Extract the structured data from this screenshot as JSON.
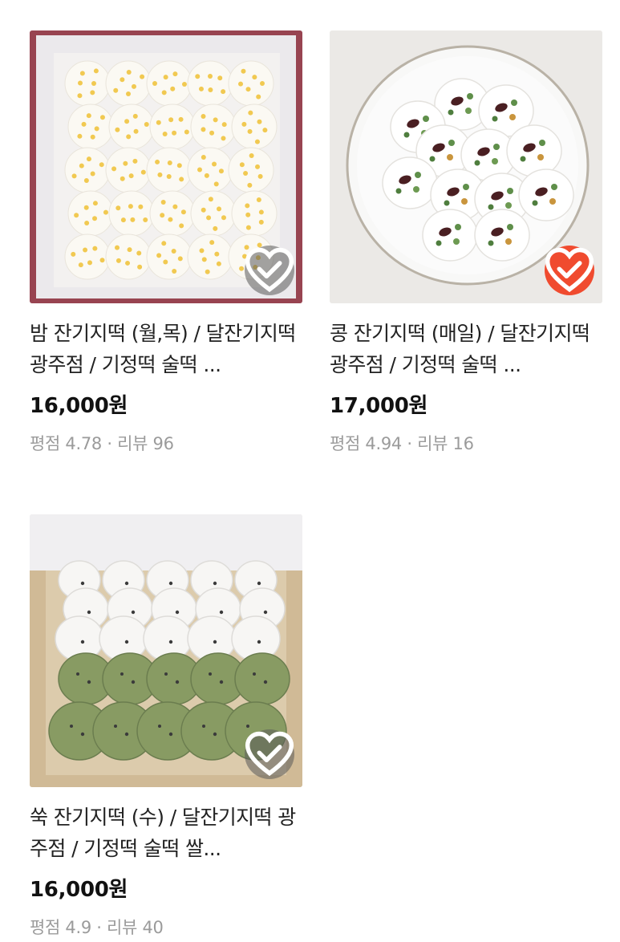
{
  "products": [
    {
      "title": "밤 잔기지떡 (월,목) / 달잔기지떡 광주점 / 기정떡 술떡 ...",
      "price": "16,000원",
      "rating": "평점 4.78 · 리뷰 96",
      "wishlisted": false
    },
    {
      "title": "콩 잔기지떡 (매일) / 달잔기지떡 광주점 / 기정떡 술떡 ...",
      "price": "17,000원",
      "rating": "평점 4.94 · 리뷰 16",
      "wishlisted": true
    },
    {
      "title": "쑥 잔기지떡 (수) / 달잔기지떡 광주점 / 기정떡 술떡 쌀...",
      "price": "16,000원",
      "rating": "평점 4.9 · 리뷰 40",
      "wishlisted": false
    }
  ],
  "icons": {
    "wishlist": "heart-check-icon"
  },
  "colors": {
    "wishlist_active": "#f04b2f",
    "rating_text": "#9b9b9b"
  }
}
